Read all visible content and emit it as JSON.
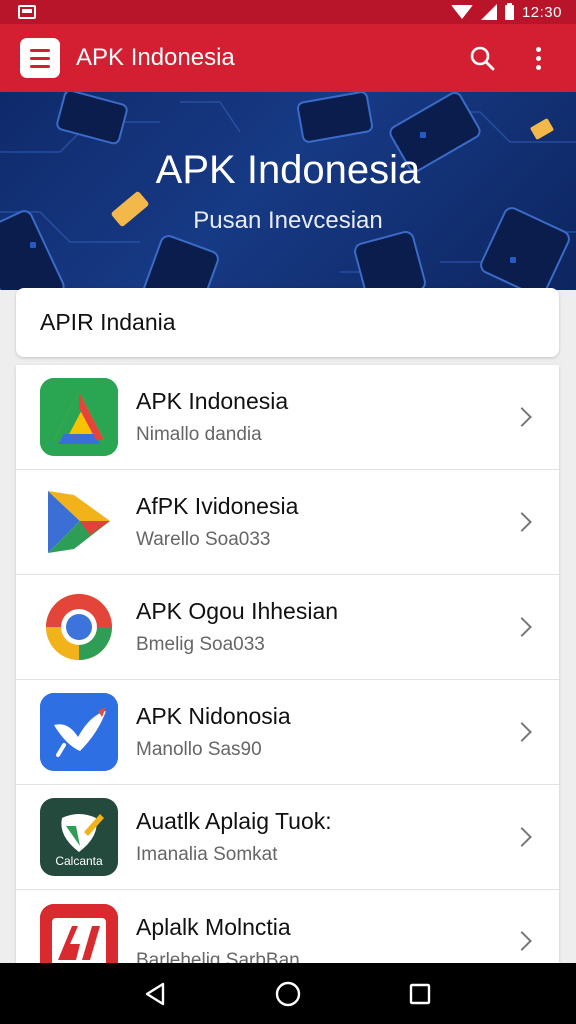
{
  "status_bar": {
    "time": "12:30"
  },
  "app_bar": {
    "title": "APK Indonesia"
  },
  "banner": {
    "title": "APK Indonesia",
    "subtitle": "Pusan Inevcesian"
  },
  "search": {
    "text": "APIR Indania"
  },
  "apps": [
    {
      "name": "APK Indonesia",
      "subtitle": "Nimallo dandia",
      "icon": "triangle-logo-icon"
    },
    {
      "name": "AfPK Ividonesia",
      "subtitle": "Warello Soa033",
      "icon": "play-logo-icon"
    },
    {
      "name": "APK Ogou Ihhesian",
      "subtitle": "Bmelig Soa033",
      "icon": "circle-logo-icon"
    },
    {
      "name": "APK Nidonosia",
      "subtitle": "Manollo Sas90",
      "icon": "bird-logo-icon"
    },
    {
      "name": "Auatlk Aplaig Tuok:",
      "subtitle": "Imanalia Somkat",
      "icon": "calculator-logo-icon",
      "icon_label": "Calcanta"
    },
    {
      "name": "Aplalk Molnctia",
      "subtitle": "Barleheliq SarbBan",
      "icon": "red-logo-icon"
    }
  ],
  "colors": {
    "status_bar": "#b8142a",
    "app_bar": "#d31f31",
    "banner": "#173a85"
  }
}
